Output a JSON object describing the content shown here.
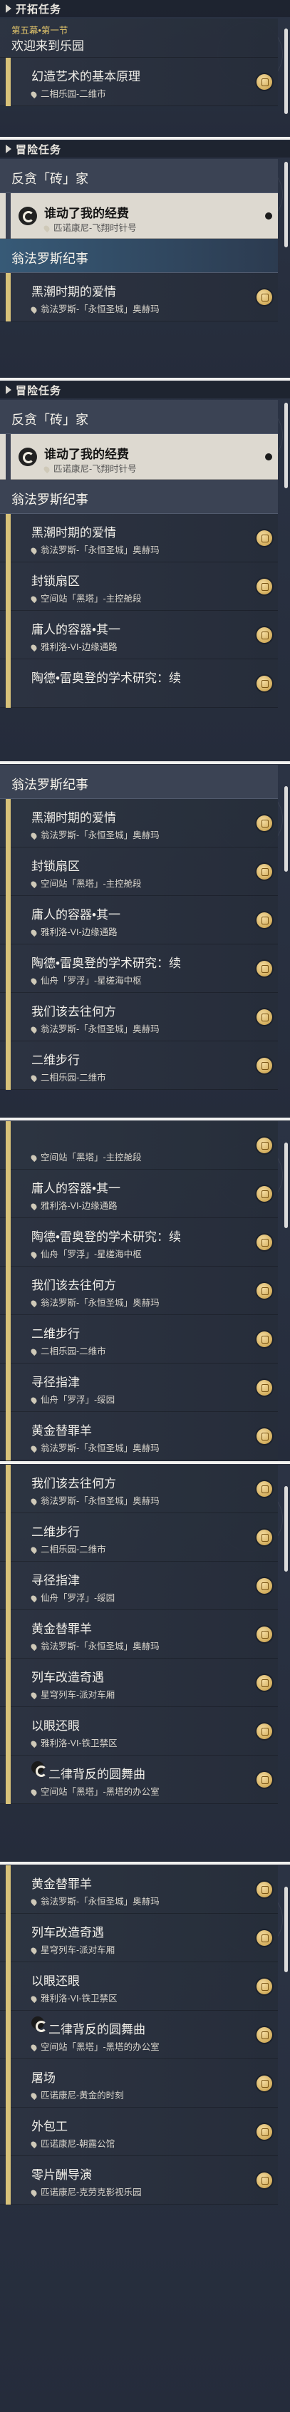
{
  "colors": {
    "background": "#2a3040",
    "accent_gold": "#d8c27a",
    "active_item": "#ddd9d0"
  },
  "panels": [
    {
      "header": "开拓任务",
      "items": [
        {
          "kind": "chapter",
          "title": "欢迎来到乐园",
          "subtitle": "第五幕•第一节"
        },
        {
          "kind": "quest",
          "title": "幻造艺术的基本原理",
          "loc": "二相乐园-二维市"
        }
      ]
    },
    {
      "header": "冒险任务",
      "items": [
        {
          "kind": "header",
          "title": "反贪「砖」家"
        },
        {
          "kind": "active",
          "title": "谁动了我的经费",
          "loc": "匹诺康尼-飞翔时针号"
        },
        {
          "kind": "header",
          "title": "翁法罗斯纪事"
        },
        {
          "kind": "quest",
          "title": "黑潮时期的爱情",
          "loc": "翁法罗斯-「永恒圣城」奥赫玛"
        }
      ]
    },
    {
      "header": "冒险任务",
      "items": [
        {
          "kind": "header",
          "title": "反贪「砖」家"
        },
        {
          "kind": "active",
          "title": "谁动了我的经费",
          "loc": "匹诺康尼-飞翔时针号"
        },
        {
          "kind": "header",
          "title": "翁法罗斯纪事"
        },
        {
          "kind": "quest",
          "title": "黑潮时期的爱情",
          "loc": "翁法罗斯-「永恒圣城」奥赫玛"
        },
        {
          "kind": "quest",
          "title": "封锁扇区",
          "loc": "空间站「黑塔」-主控舱段"
        },
        {
          "kind": "quest",
          "title": "庸人的容器•其一",
          "loc": "雅利洛-VI-边缘通路"
        },
        {
          "kind": "quest",
          "title": "陶德•雷奥登的学术研究：续",
          "loc": ""
        }
      ]
    },
    {
      "header": "",
      "items": [
        {
          "kind": "header",
          "title": "翁法罗斯纪事"
        },
        {
          "kind": "quest",
          "title": "黑潮时期的爱情",
          "loc": "翁法罗斯-「永恒圣城」奥赫玛"
        },
        {
          "kind": "quest",
          "title": "封锁扇区",
          "loc": "空间站「黑塔」-主控舱段"
        },
        {
          "kind": "quest",
          "title": "庸人的容器•其一",
          "loc": "雅利洛-VI-边缘通路"
        },
        {
          "kind": "quest",
          "title": "陶德•雷奥登的学术研究：续",
          "loc": "仙舟「罗浮」-星槎海中枢"
        },
        {
          "kind": "quest",
          "title": "我们该去往何方",
          "loc": "翁法罗斯-「永恒圣城」奥赫玛"
        },
        {
          "kind": "quest",
          "title": "二维步行",
          "loc": "二相乐园-二维市"
        }
      ]
    },
    {
      "header": "",
      "items": [
        {
          "kind": "quest",
          "title": "",
          "loc": "空间站「黑塔」-主控舱段"
        },
        {
          "kind": "quest",
          "title": "庸人的容器•其一",
          "loc": "雅利洛-VI-边缘通路"
        },
        {
          "kind": "quest",
          "title": "陶德•雷奥登的学术研究：续",
          "loc": "仙舟「罗浮」-星槎海中枢"
        },
        {
          "kind": "quest",
          "title": "我们该去往何方",
          "loc": "翁法罗斯-「永恒圣城」奥赫玛"
        },
        {
          "kind": "quest",
          "title": "二维步行",
          "loc": "二相乐园-二维市"
        },
        {
          "kind": "quest",
          "title": "寻径指津",
          "loc": "仙舟「罗浮」-绥园"
        },
        {
          "kind": "quest",
          "title": "黄金替罪羊",
          "loc": "翁法罗斯-「永恒圣城」奥赫玛"
        }
      ]
    },
    {
      "header": "",
      "items": [
        {
          "kind": "quest",
          "title": "我们该去往何方",
          "loc": "翁法罗斯-「永恒圣城」奥赫玛"
        },
        {
          "kind": "quest",
          "title": "二维步行",
          "loc": "二相乐园-二维市"
        },
        {
          "kind": "quest",
          "title": "寻径指津",
          "loc": "仙舟「罗浮」-绥园"
        },
        {
          "kind": "quest",
          "title": "黄金替罪羊",
          "loc": "翁法罗斯-「永恒圣城」奥赫玛"
        },
        {
          "kind": "quest",
          "title": "列车改造奇遇",
          "loc": "星穹列车-派对车厢"
        },
        {
          "kind": "quest",
          "title": "以眼还眼",
          "loc": "雅利洛-VI-铁卫禁区"
        },
        {
          "kind": "spiral",
          "title": "二律背反的圆舞曲",
          "loc": "空间站「黑塔」-黑塔的办公室"
        }
      ]
    },
    {
      "header": "",
      "items": [
        {
          "kind": "quest",
          "title": "黄金替罪羊",
          "loc": "翁法罗斯-「永恒圣城」奥赫玛"
        },
        {
          "kind": "quest",
          "title": "列车改造奇遇",
          "loc": "星穹列车-派对车厢"
        },
        {
          "kind": "quest",
          "title": "以眼还眼",
          "loc": "雅利洛-VI-铁卫禁区"
        },
        {
          "kind": "spiral",
          "title": "二律背反的圆舞曲",
          "loc": "空间站「黑塔」-黑塔的办公室"
        },
        {
          "kind": "quest",
          "title": "屠场",
          "loc": "匹诺康尼-黄金的时刻"
        },
        {
          "kind": "quest",
          "title": "外包工",
          "loc": "匹诺康尼-朝露公馆"
        },
        {
          "kind": "quest",
          "title": "零片酬导演",
          "loc": "匹诺康尼-克劳克影视乐园"
        }
      ]
    }
  ]
}
